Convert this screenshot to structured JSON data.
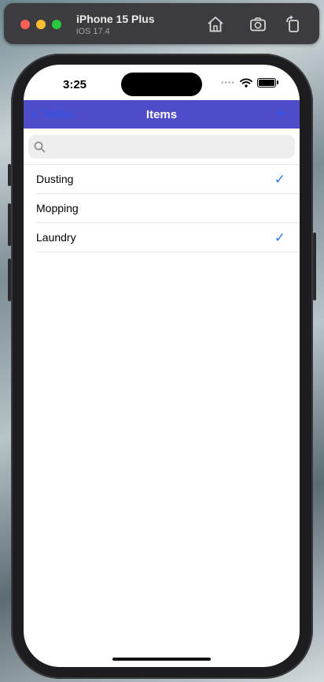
{
  "window": {
    "device_name": "iPhone 15 Plus",
    "os_version": "iOS 17.4",
    "icons": [
      "home-icon",
      "screenshot-icon",
      "rotate-icon"
    ]
  },
  "status_bar": {
    "time": "3:25",
    "icons": [
      "cellular-dots-icon",
      "wifi-icon",
      "battery-icon"
    ]
  },
  "navbar": {
    "back_label": "Todos",
    "title": "Items",
    "add_label": "+",
    "background": "#4f4cc9",
    "tint": "#2a52f0"
  },
  "search": {
    "placeholder": "",
    "value": ""
  },
  "items": [
    {
      "label": "Dusting",
      "checked": true,
      "check_glyph": "✓"
    },
    {
      "label": "Mopping",
      "checked": false,
      "check_glyph": ""
    },
    {
      "label": "Laundry",
      "checked": true,
      "check_glyph": "✓"
    }
  ],
  "colors": {
    "checkmark": "#2a7de1"
  }
}
